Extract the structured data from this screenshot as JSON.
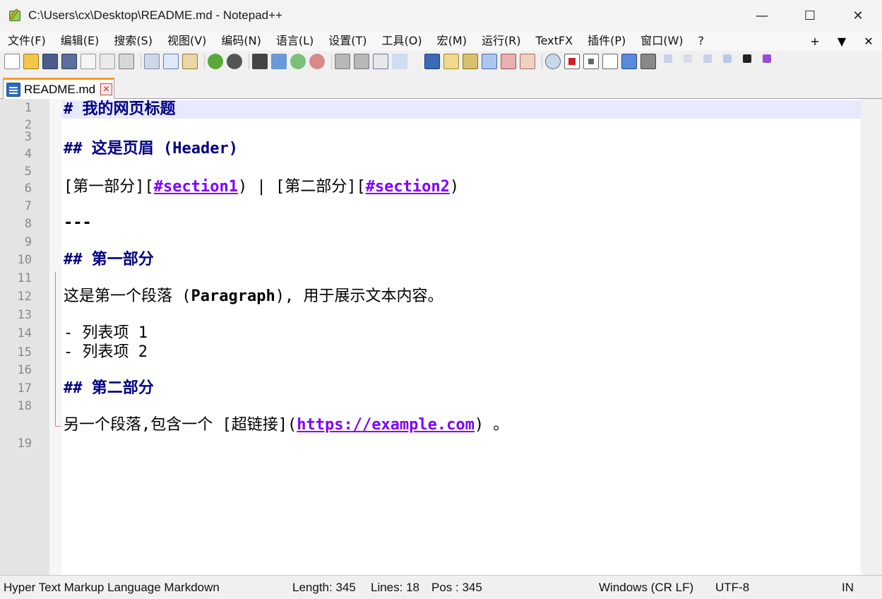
{
  "window": {
    "title": "C:\\Users\\cx\\Desktop\\README.md - Notepad++",
    "minimize": "—",
    "maximize": "☐",
    "close": "✕"
  },
  "menu": {
    "items": [
      "文件(F)",
      "编辑(E)",
      "搜索(S)",
      "视图(V)",
      "编码(N)",
      "语言(L)",
      "设置(T)",
      "工具(O)",
      "宏(M)",
      "运行(R)",
      "TextFX",
      "插件(P)",
      "窗口(W)",
      "?"
    ],
    "right_plus": "+",
    "right_arrow": "▼",
    "right_close": "✕"
  },
  "toolbar": {
    "icons": [
      "new-file-icon",
      "open-file-icon",
      "save-icon",
      "save-all-icon",
      "close-icon",
      "close-all-icon",
      "print-icon",
      "cut-icon",
      "copy-icon",
      "paste-icon",
      "undo-icon",
      "redo-icon",
      "find-icon",
      "replace-icon",
      "zoom-in-icon",
      "zoom-out-icon",
      "sync-v-icon",
      "sync-h-icon",
      "wrap-icon",
      "show-all-chars-icon",
      "dropdown-icon",
      "indent-guide-icon",
      "doc-map-icon",
      "function-list-icon",
      "folder-workspace-icon",
      "monitor-icon",
      "fold-icon",
      "eye-icon",
      "record-macro-icon",
      "stop-macro-icon",
      "play-macro-icon",
      "run-macro-multiple-icon",
      "save-macro-icon"
    ]
  },
  "tab": {
    "label": "README.md",
    "close": "✕"
  },
  "editor": {
    "line_numbers": [
      "1",
      "2",
      "3",
      "4",
      "5",
      "6",
      "7",
      "8",
      "9",
      "10",
      "11",
      "12",
      "13",
      "14",
      "15",
      "16",
      "17",
      "18",
      "19"
    ],
    "lines": {
      "l1": "# 我的网页标题",
      "l4": "## 这是页眉 (Header)",
      "l6_a": "[第一部分][",
      "l6_link1": "#section1",
      "l6_b": ") | [第二部分][",
      "l6_link2": "#section2",
      "l6_c": ")",
      "l8": "---",
      "l10": "## 第一部分",
      "l12_a": "这是第一个段落 (",
      "l12_bold": "Paragraph",
      "l12_b": "), 用于展示文本内容。",
      "l14": "- 列表项 1",
      "l15": "- 列表项 2",
      "l16": "## 第二部分",
      "l18_a": "另一个段落,包含一个 [超链接](",
      "l18_link": "https://example.com",
      "l18_b": ") 。"
    }
  },
  "status": {
    "language": "Hyper Text Markup Language Markdown",
    "length": "Length: 345",
    "lines": "Lines: 18",
    "pos": "Pos : 345",
    "eol": "Windows (CR LF)",
    "encoding": "UTF-8",
    "mode": "IN"
  },
  "colors": {
    "heading": "#000080",
    "link": "#8000ff",
    "current_line": "#e8e8ff",
    "tab_accent": "#fa9b24"
  }
}
